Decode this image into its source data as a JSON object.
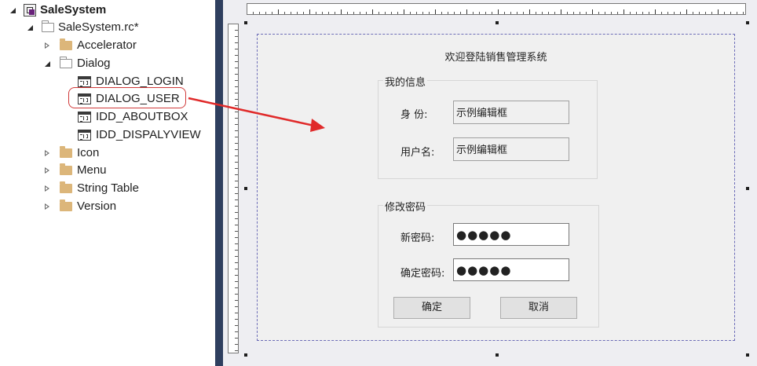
{
  "tree": {
    "root": {
      "label": "SaleSystem"
    },
    "rc_file": {
      "label": "SaleSystem.rc*"
    },
    "accelerator": {
      "label": "Accelerator"
    },
    "dialog_folder": {
      "label": "Dialog"
    },
    "dialogs": [
      {
        "label": "DIALOG_LOGIN"
      },
      {
        "label": "DIALOG_USER"
      },
      {
        "label": "IDD_ABOUTBOX"
      },
      {
        "label": "IDD_DISPALYVIEW"
      }
    ],
    "icon_folder": {
      "label": "Icon"
    },
    "menu_folder": {
      "label": "Menu"
    },
    "string_table": {
      "label": "String Table"
    },
    "version": {
      "label": "Version"
    }
  },
  "dialog": {
    "title": "欢迎登陆销售管理系统",
    "my_info": {
      "caption": "我的信息",
      "identity_label": "身  份:",
      "identity_value": "示例编辑框",
      "username_label": "用户名:",
      "username_value": "示例编辑框"
    },
    "change_password": {
      "caption": "修改密码",
      "new_password_label": "新密码:",
      "new_password_value": "●●●●●",
      "confirm_password_label": "确定密码:",
      "confirm_password_value": "●●●●●"
    },
    "buttons": {
      "ok": "确定",
      "cancel": "取消"
    }
  },
  "colors": {
    "splitter": "#2f3f5f",
    "designer_bg": "#eeeef2",
    "annotation": "#e02a2a",
    "folder": "#dcb67a"
  }
}
